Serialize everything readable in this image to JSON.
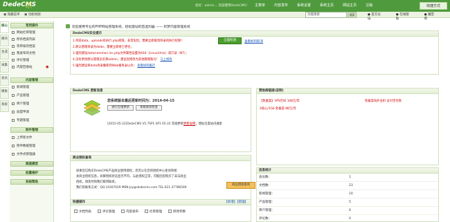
{
  "header": {
    "logo": "DedeCMS",
    "version": "V5.7",
    "version_badge": "GBK",
    "welcome": "您好：admin ，欢迎使用DedeCMS！",
    "nav": [
      "主菜单",
      "内容发布",
      "系统设置",
      "系统主页",
      "网站主页",
      "注销"
    ],
    "quick_menu": "快捷方式"
  },
  "subbar": {
    "hide_menu": "隐藏菜单",
    "site_map": "功能地图",
    "search_placeholder": "功能搜索",
    "search_button": "搜索",
    "links": [
      "官方论坛",
      "在线帮助",
      "魔宏吧"
    ]
  },
  "vtabs": [
    "核心",
    "模块",
    "生成",
    "采集",
    "会员",
    "模板",
    "系统"
  ],
  "sidebar": {
    "sections": [
      {
        "title": "常用操作",
        "items": [
          "网站栏目管理",
          "所有档案列表",
          "等审核的档案",
          "我发布的文档",
          "评论管理",
          "内容回收站"
        ]
      },
      {
        "title": "内容管理",
        "items": [
          "新闻管理",
          "产品管理",
          "简介管理",
          "加盟申请",
          "专题管理"
        ]
      },
      {
        "title": "附件管理",
        "items": [
          "上传新文件",
          "附件数据管理",
          "文件式管理器"
        ]
      },
      {
        "title": "频道模型"
      },
      {
        "title": "批量维护"
      },
      {
        "title": "系统帮助"
      }
    ]
  },
  "main": {
    "welcome": "欢迎使用专业的PHP网站管理系统，轻松建站的首选利器 —— 织梦内容管理系统",
    "security": {
      "title": "DedeCMS安全提示",
      "alerts": [
        "1.目前data、uploads有执行.php权限，非常危险，需要立即取消目录的执行权限！",
        "2.默认管理目录为dede，需要立即将它更名；",
        "3.强烈建议data/common.inc.php文件属性设置为644（Linux/Unix）或只读（NT）；",
        "4.没有更改默认管理员名称admin，建议您修改为其他管理账号！",
        "5.强烈建议将data目录搬移到Web根目录以外；"
      ],
      "alert4_link": "马上修改",
      "alert5_link": "查看如何搬迁",
      "check_button": "全面检测",
      "cancel_link": "查看如何取消"
    },
    "update": {
      "title": "DedeCMS 更新消息",
      "headline": "您系统版本最后更新时间为：2014-04-15",
      "btn_online": "进行在线更新",
      "btn_check": "系统修改检查",
      "message": "[2015-05-22]DedeCMS V5.7SP1 SP1 05-22 常规更新",
      "msg_link": "更新说明",
      "msg_tail": "，增加百度站内搜索"
    },
    "business": {
      "title": "商业授权查询",
      "text": [
        "如果您已购买DedeCMS产品商业使用授权，您可以在您的授权中心查询到相",
        "关商业授权信息，如果授权状态显示不符，与此授权正常，可能因您购买了非法商业",
        "授权，请及时和我们取得联系。",
        "我们的联系方式：QQ:10307029 MSN:jsy@dedecms.com TEL:021-37786569"
      ],
      "button": "商业授权查询"
    },
    "sponsor": {
      "title": "赞助商链接",
      "title_note": "(说明)",
      "line1_tag": "【免备案】",
      "line1_text": "VPS空间 108元/年",
      "line1_right": "免备案海外主机 支付宝付款",
      "line2": "2核心/1Gb 免备案 88元/月"
    },
    "stats": {
      "title": "信息统计",
      "rows": [
        {
          "label": "会员数：",
          "value": "1"
        },
        {
          "label": "文档数：",
          "value": "23"
        },
        {
          "label": "新闻管理：",
          "value": "10"
        },
        {
          "label": "产品管理：",
          "value": "5"
        },
        {
          "label": "简介管理：",
          "value": "6"
        },
        {
          "label": "评论数：",
          "value": "0"
        }
      ]
    },
    "quick": {
      "title": "快捷操作",
      "actions": "【新增】【管理】",
      "links": [
        "文档列表",
        "评论管理",
        "内容发布",
        "栏目管理",
        "修改参数"
      ]
    }
  }
}
